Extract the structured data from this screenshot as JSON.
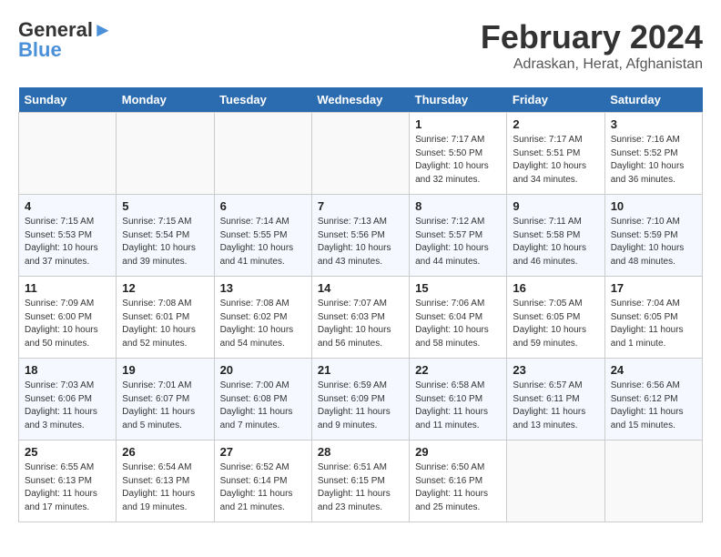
{
  "header": {
    "logo_general": "General",
    "logo_blue": "Blue",
    "month_year": "February 2024",
    "location": "Adraskan, Herat, Afghanistan"
  },
  "days_of_week": [
    "Sunday",
    "Monday",
    "Tuesday",
    "Wednesday",
    "Thursday",
    "Friday",
    "Saturday"
  ],
  "weeks": [
    [
      {
        "day": "",
        "info": ""
      },
      {
        "day": "",
        "info": ""
      },
      {
        "day": "",
        "info": ""
      },
      {
        "day": "",
        "info": ""
      },
      {
        "day": "1",
        "info": "Sunrise: 7:17 AM\nSunset: 5:50 PM\nDaylight: 10 hours\nand 32 minutes."
      },
      {
        "day": "2",
        "info": "Sunrise: 7:17 AM\nSunset: 5:51 PM\nDaylight: 10 hours\nand 34 minutes."
      },
      {
        "day": "3",
        "info": "Sunrise: 7:16 AM\nSunset: 5:52 PM\nDaylight: 10 hours\nand 36 minutes."
      }
    ],
    [
      {
        "day": "4",
        "info": "Sunrise: 7:15 AM\nSunset: 5:53 PM\nDaylight: 10 hours\nand 37 minutes."
      },
      {
        "day": "5",
        "info": "Sunrise: 7:15 AM\nSunset: 5:54 PM\nDaylight: 10 hours\nand 39 minutes."
      },
      {
        "day": "6",
        "info": "Sunrise: 7:14 AM\nSunset: 5:55 PM\nDaylight: 10 hours\nand 41 minutes."
      },
      {
        "day": "7",
        "info": "Sunrise: 7:13 AM\nSunset: 5:56 PM\nDaylight: 10 hours\nand 43 minutes."
      },
      {
        "day": "8",
        "info": "Sunrise: 7:12 AM\nSunset: 5:57 PM\nDaylight: 10 hours\nand 44 minutes."
      },
      {
        "day": "9",
        "info": "Sunrise: 7:11 AM\nSunset: 5:58 PM\nDaylight: 10 hours\nand 46 minutes."
      },
      {
        "day": "10",
        "info": "Sunrise: 7:10 AM\nSunset: 5:59 PM\nDaylight: 10 hours\nand 48 minutes."
      }
    ],
    [
      {
        "day": "11",
        "info": "Sunrise: 7:09 AM\nSunset: 6:00 PM\nDaylight: 10 hours\nand 50 minutes."
      },
      {
        "day": "12",
        "info": "Sunrise: 7:08 AM\nSunset: 6:01 PM\nDaylight: 10 hours\nand 52 minutes."
      },
      {
        "day": "13",
        "info": "Sunrise: 7:08 AM\nSunset: 6:02 PM\nDaylight: 10 hours\nand 54 minutes."
      },
      {
        "day": "14",
        "info": "Sunrise: 7:07 AM\nSunset: 6:03 PM\nDaylight: 10 hours\nand 56 minutes."
      },
      {
        "day": "15",
        "info": "Sunrise: 7:06 AM\nSunset: 6:04 PM\nDaylight: 10 hours\nand 58 minutes."
      },
      {
        "day": "16",
        "info": "Sunrise: 7:05 AM\nSunset: 6:05 PM\nDaylight: 10 hours\nand 59 minutes."
      },
      {
        "day": "17",
        "info": "Sunrise: 7:04 AM\nSunset: 6:05 PM\nDaylight: 11 hours\nand 1 minute."
      }
    ],
    [
      {
        "day": "18",
        "info": "Sunrise: 7:03 AM\nSunset: 6:06 PM\nDaylight: 11 hours\nand 3 minutes."
      },
      {
        "day": "19",
        "info": "Sunrise: 7:01 AM\nSunset: 6:07 PM\nDaylight: 11 hours\nand 5 minutes."
      },
      {
        "day": "20",
        "info": "Sunrise: 7:00 AM\nSunset: 6:08 PM\nDaylight: 11 hours\nand 7 minutes."
      },
      {
        "day": "21",
        "info": "Sunrise: 6:59 AM\nSunset: 6:09 PM\nDaylight: 11 hours\nand 9 minutes."
      },
      {
        "day": "22",
        "info": "Sunrise: 6:58 AM\nSunset: 6:10 PM\nDaylight: 11 hours\nand 11 minutes."
      },
      {
        "day": "23",
        "info": "Sunrise: 6:57 AM\nSunset: 6:11 PM\nDaylight: 11 hours\nand 13 minutes."
      },
      {
        "day": "24",
        "info": "Sunrise: 6:56 AM\nSunset: 6:12 PM\nDaylight: 11 hours\nand 15 minutes."
      }
    ],
    [
      {
        "day": "25",
        "info": "Sunrise: 6:55 AM\nSunset: 6:13 PM\nDaylight: 11 hours\nand 17 minutes."
      },
      {
        "day": "26",
        "info": "Sunrise: 6:54 AM\nSunset: 6:13 PM\nDaylight: 11 hours\nand 19 minutes."
      },
      {
        "day": "27",
        "info": "Sunrise: 6:52 AM\nSunset: 6:14 PM\nDaylight: 11 hours\nand 21 minutes."
      },
      {
        "day": "28",
        "info": "Sunrise: 6:51 AM\nSunset: 6:15 PM\nDaylight: 11 hours\nand 23 minutes."
      },
      {
        "day": "29",
        "info": "Sunrise: 6:50 AM\nSunset: 6:16 PM\nDaylight: 11 hours\nand 25 minutes."
      },
      {
        "day": "",
        "info": ""
      },
      {
        "day": "",
        "info": ""
      }
    ]
  ]
}
